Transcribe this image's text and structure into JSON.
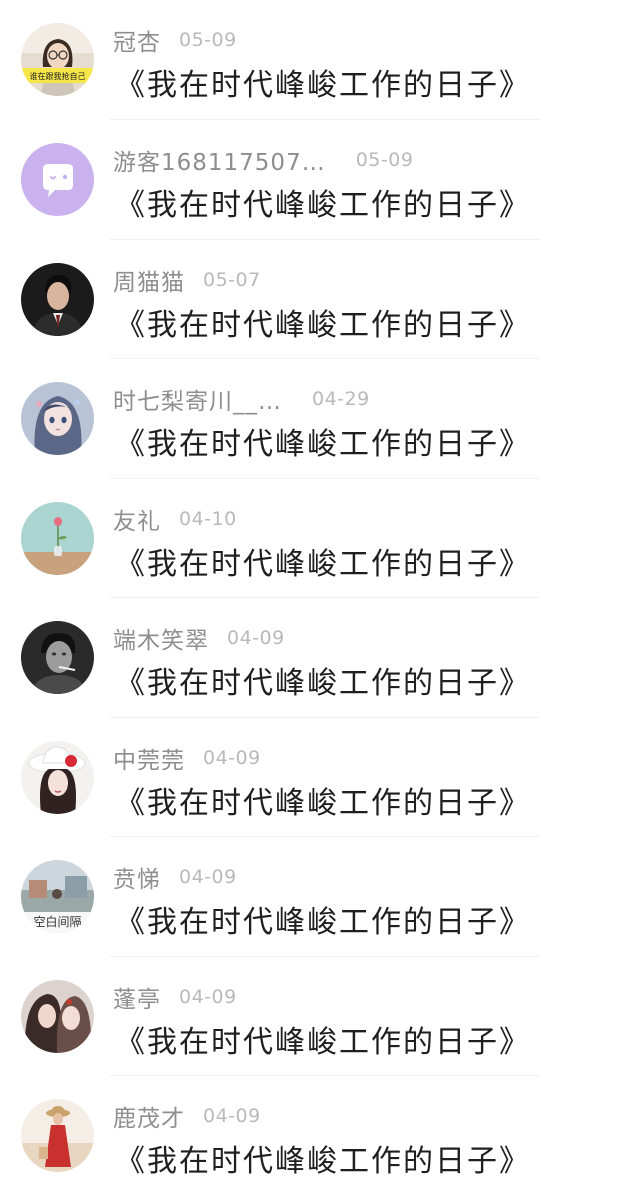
{
  "comments": [
    {
      "username": "冠杏",
      "date": "05-09",
      "text": "《我在时代峰峻工作的日子》",
      "avatar_icon": "avatar-girl-glasses-sticker",
      "avatar_caption": "谁在跟我抢自己"
    },
    {
      "username": "游客168117507…",
      "date": "05-09",
      "text": "《我在时代峰峻工作的日子》",
      "avatar_icon": "avatar-default-chat-bubble",
      "avatar_color": "#c9b2ee"
    },
    {
      "username": "周猫猫",
      "date": "05-07",
      "text": "《我在时代峰峻工作的日子》",
      "avatar_icon": "avatar-man-photo"
    },
    {
      "username": "时七梨寄川__…",
      "date": "04-29",
      "text": "《我在时代峰峻工作的日子》",
      "avatar_icon": "avatar-anime-girl"
    },
    {
      "username": "友礼",
      "date": "04-10",
      "text": "《我在时代峰峻工作的日子》",
      "avatar_icon": "avatar-flower-vase"
    },
    {
      "username": "端木笑翠",
      "date": "04-09",
      "text": "《我在时代峰峻工作的日子》",
      "avatar_icon": "avatar-bw-smoking-man"
    },
    {
      "username": "中莞莞",
      "date": "04-09",
      "text": "《我在时代峰峻工作的日子》",
      "avatar_icon": "avatar-girl-white-hat"
    },
    {
      "username": "贲悌",
      "date": "04-09",
      "text": "《我在时代峰峻工作的日子》",
      "avatar_icon": "avatar-street-scene",
      "avatar_caption": "空白间隔"
    },
    {
      "username": "蓬亭",
      "date": "04-09",
      "text": "《我在时代峰峻工作的日子》",
      "avatar_icon": "avatar-couple-illustration"
    },
    {
      "username": "鹿茂才",
      "date": "04-09",
      "text": "《我在时代峰峻工作的日子》",
      "avatar_icon": "avatar-girl-beach"
    }
  ]
}
